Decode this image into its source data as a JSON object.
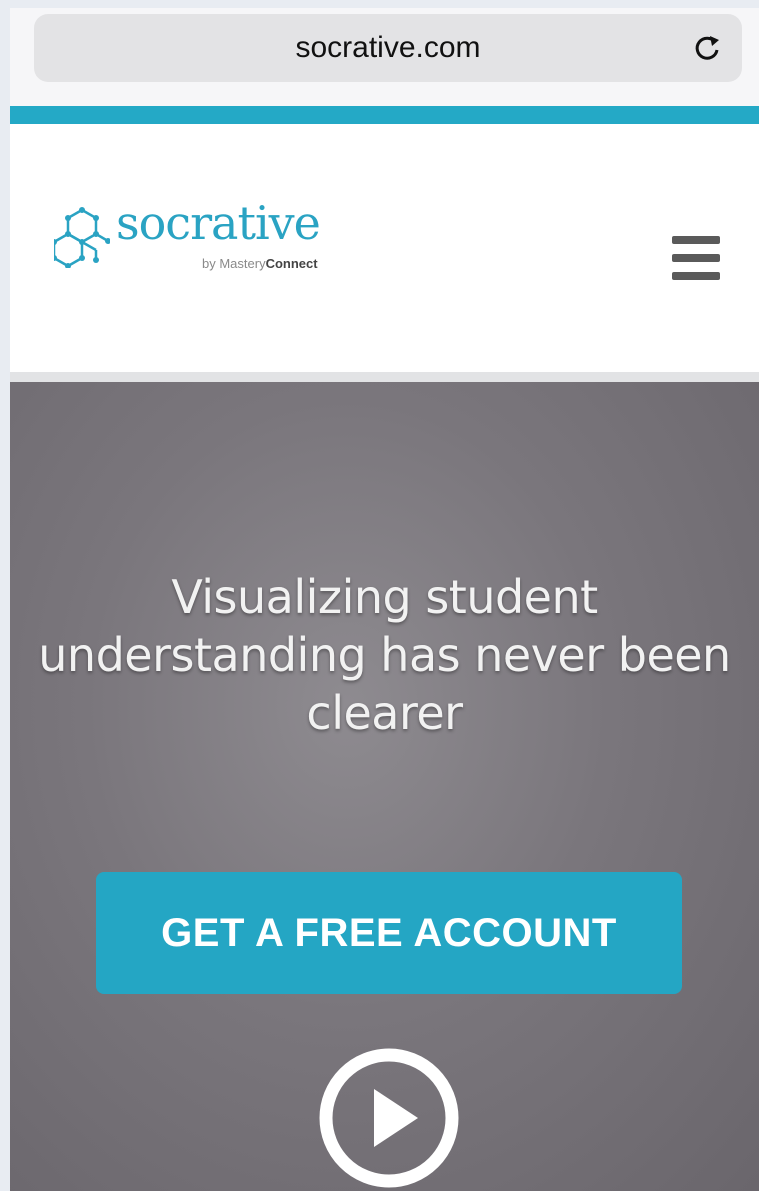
{
  "browser": {
    "url": "socrative.com",
    "reload_icon": "reload-icon"
  },
  "header": {
    "logo_word": "socrative",
    "logo_by": "by Mastery",
    "logo_by_brand": "Connect",
    "menu_icon": "hamburger-menu-icon"
  },
  "hero": {
    "headline": "Visualizing student understanding has never been clearer",
    "cta_label": "GET A FREE ACCOUNT",
    "play_icon": "play-video-icon"
  },
  "colors": {
    "accent": "#24a9c6",
    "brand_text": "#2aa3c3",
    "hero_bg": "#7a767c"
  }
}
